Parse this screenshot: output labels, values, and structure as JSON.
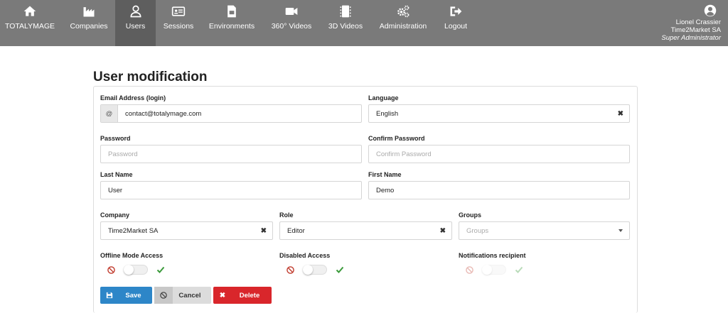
{
  "nav": {
    "items": [
      {
        "label": "TOTALYMAGE",
        "icon": "home-icon"
      },
      {
        "label": "Companies",
        "icon": "factory-icon"
      },
      {
        "label": "Users",
        "icon": "user-icon"
      },
      {
        "label": "Sessions",
        "icon": "id-card-icon"
      },
      {
        "label": "Environments",
        "icon": "file-icon"
      },
      {
        "label": "360° Videos",
        "icon": "video-camera-icon"
      },
      {
        "label": "3D Videos",
        "icon": "film-icon"
      },
      {
        "label": "Administration",
        "icon": "cogs-icon"
      },
      {
        "label": "Logout",
        "icon": "sign-out-icon"
      }
    ],
    "active": "Users"
  },
  "user": {
    "name": "Lionel Crassier",
    "company": "Time2Market SA",
    "role": "Super Administrator"
  },
  "page": {
    "title": "User modification"
  },
  "form": {
    "email": {
      "label": "Email Address (login)",
      "addon": "@",
      "value": "contact@totalymage.com"
    },
    "language": {
      "label": "Language",
      "value": "English"
    },
    "password": {
      "label": "Password",
      "placeholder": "Password"
    },
    "confirm_password": {
      "label": "Confirm Password",
      "placeholder": "Confirm Password"
    },
    "last_name": {
      "label": "Last Name",
      "value": "User"
    },
    "first_name": {
      "label": "First Name",
      "value": "Demo"
    },
    "company": {
      "label": "Company",
      "value": "Time2Market SA"
    },
    "role": {
      "label": "Role",
      "value": "Editor"
    },
    "groups": {
      "label": "Groups",
      "placeholder": "Groups"
    },
    "offline_mode": {
      "label": "Offline Mode Access",
      "enabled": false
    },
    "disabled_access": {
      "label": "Disabled Access",
      "enabled": false
    },
    "notifications": {
      "label": "Notifications recipient",
      "enabled": false,
      "disabled": true
    }
  },
  "buttons": {
    "save": "Save",
    "cancel": "Cancel",
    "delete": "Delete"
  },
  "colors": {
    "topbar": "#7a7a7a",
    "active_tab": "#5e5e5e",
    "save": "#2d86c8",
    "cancel": "#dcdcdc",
    "delete": "#d9262b",
    "check": "#3a9a3a",
    "ban": "#c0392b"
  }
}
